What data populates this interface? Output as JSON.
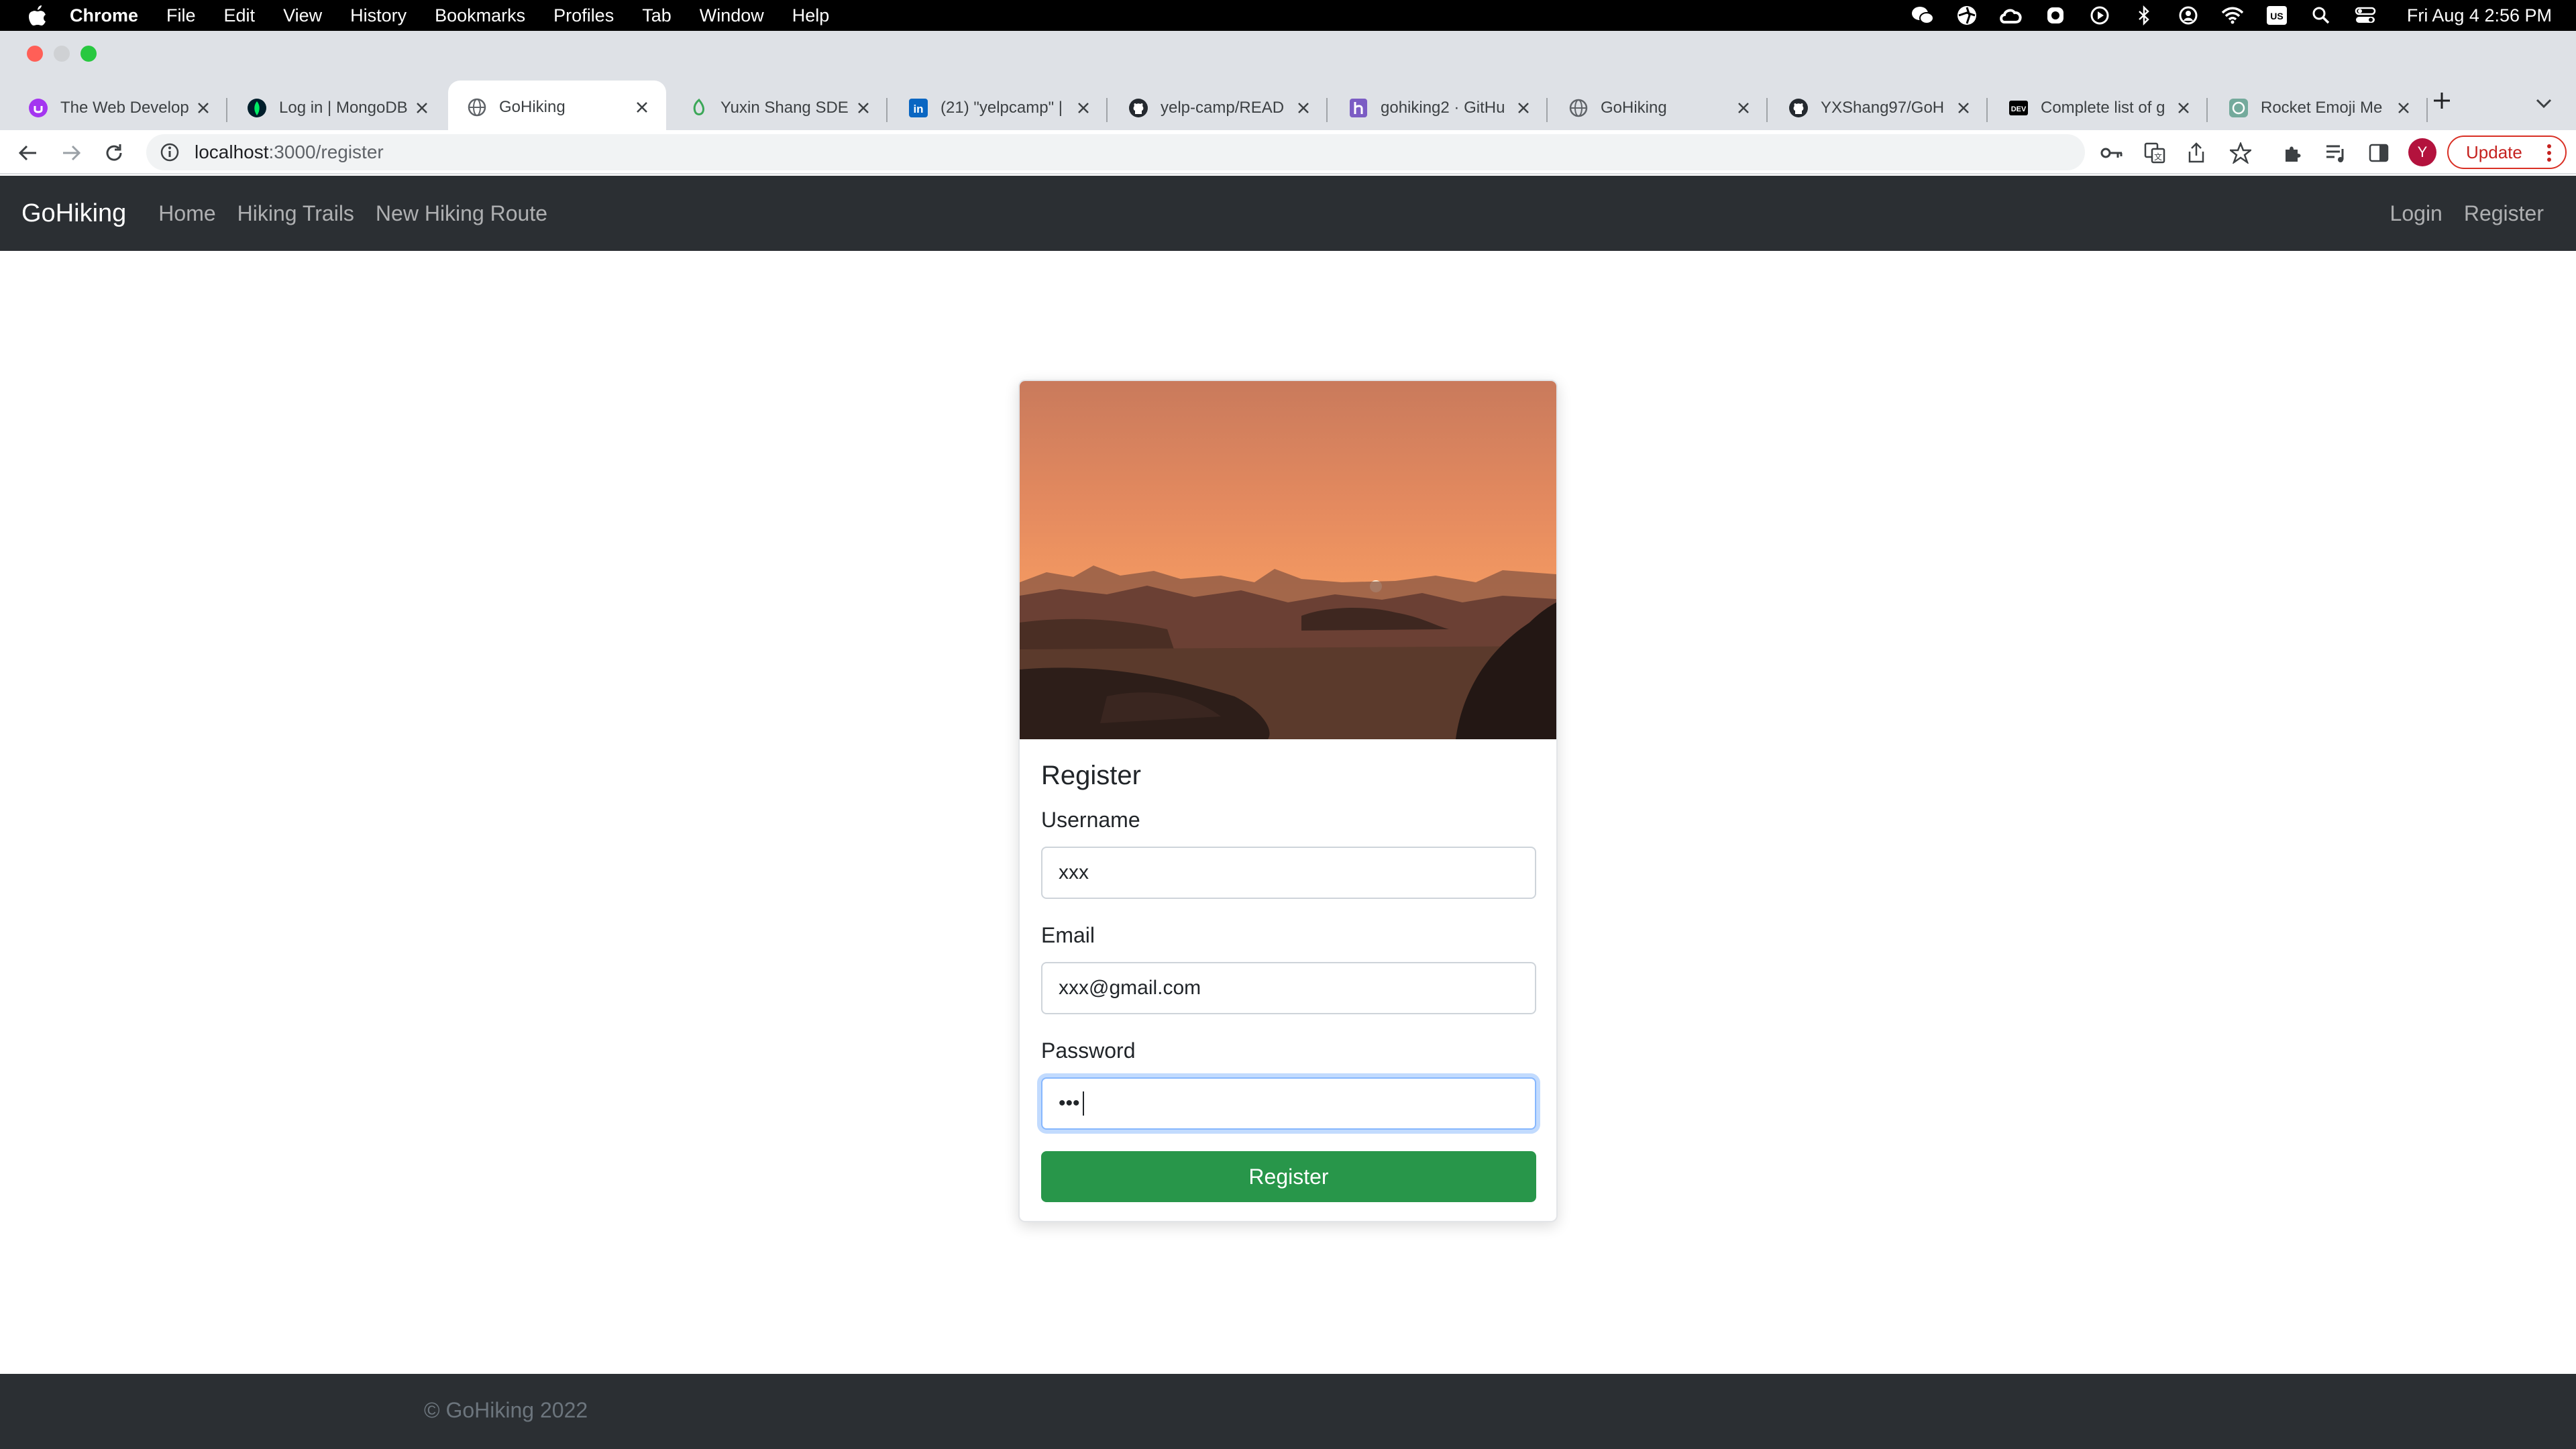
{
  "macos_menubar": {
    "app_name": "Chrome",
    "menus": [
      "File",
      "Edit",
      "View",
      "History",
      "Bookmarks",
      "Profiles",
      "Tab",
      "Window",
      "Help"
    ],
    "status_icons": [
      "wechat-icon",
      "aperture-icon",
      "creative-cloud-icon",
      "record-icon",
      "play-icon",
      "bluetooth-icon",
      "user-circle-icon",
      "wifi-icon",
      "input-source-icon",
      "spotlight-search-icon",
      "control-center-icon"
    ],
    "input_source": "US",
    "clock": "Fri Aug 4  2:56 PM"
  },
  "browser": {
    "tabs": [
      {
        "title": "The Web Develop",
        "favicon_color": "#a435f0"
      },
      {
        "title": "Log in | MongoDB",
        "favicon_color": "#001e2b"
      },
      {
        "title": "GoHiking",
        "favicon_color": "#5f6368",
        "active": true
      },
      {
        "title": "Yuxin Shang SDE",
        "favicon_color": "#3aa757"
      },
      {
        "title": "(21) \"yelpcamp\" |",
        "favicon_color": "#0a66c2"
      },
      {
        "title": "yelp-camp/READ",
        "favicon_color": "#24292f"
      },
      {
        "title": "gohiking2 · GitHu",
        "favicon_color": "#7b5cc4"
      },
      {
        "title": "GoHiking",
        "favicon_color": "#5f6368"
      },
      {
        "title": "YXShang97/GoH",
        "favicon_color": "#24292f"
      },
      {
        "title": "Complete list of g",
        "favicon_color": "#000000"
      },
      {
        "title": "Rocket Emoji Me",
        "favicon_color": "#74aa9c"
      }
    ],
    "address": {
      "host": "localhost",
      "path": ":3000/register"
    },
    "profile_initial": "Y",
    "update_label": "Update"
  },
  "site": {
    "brand": "GoHiking",
    "nav_links": [
      "Home",
      "Hiking Trails",
      "New Hiking Route"
    ],
    "nav_right": [
      "Login",
      "Register"
    ],
    "form": {
      "title": "Register",
      "username_label": "Username",
      "username_value": "xxx",
      "email_label": "Email",
      "email_value": "xxx@gmail.com",
      "password_label": "Password",
      "password_value": "•••",
      "submit_label": "Register"
    },
    "footer_text": "© GoHiking 2022"
  },
  "colors": {
    "navbar_bg": "#2b2f33",
    "submit_green": "#28964a",
    "focus_blue": "#86b7fe"
  }
}
